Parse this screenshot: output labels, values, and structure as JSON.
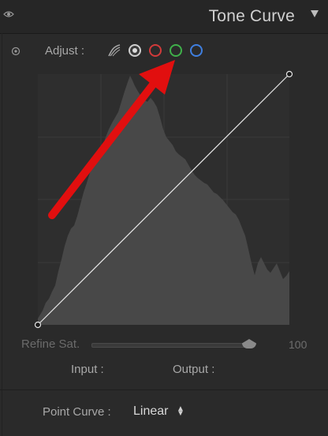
{
  "header": {
    "title": "Tone Curve"
  },
  "adjust": {
    "label": "Adjust :",
    "channels": [
      {
        "name": "parametric",
        "icon": "parametric-curve-icon"
      },
      {
        "name": "rgb",
        "color": "#d0d0d0",
        "selected": true
      },
      {
        "name": "red",
        "color": "#d23a3a"
      },
      {
        "name": "green",
        "color": "#3fb04a"
      },
      {
        "name": "blue",
        "color": "#3f7fe0"
      }
    ]
  },
  "annotation": {
    "arrow_color": "#e10f0f"
  },
  "refine": {
    "label": "Refine Sat.",
    "value": "100"
  },
  "readout": {
    "input_label": "Input :",
    "output_label": "Output :"
  },
  "point_curve": {
    "label": "Point Curve :",
    "value": "Linear"
  },
  "colors": {
    "histogram": "#4a4a4a",
    "curve": "#e6e6e6",
    "background": "#2a2a2a"
  }
}
